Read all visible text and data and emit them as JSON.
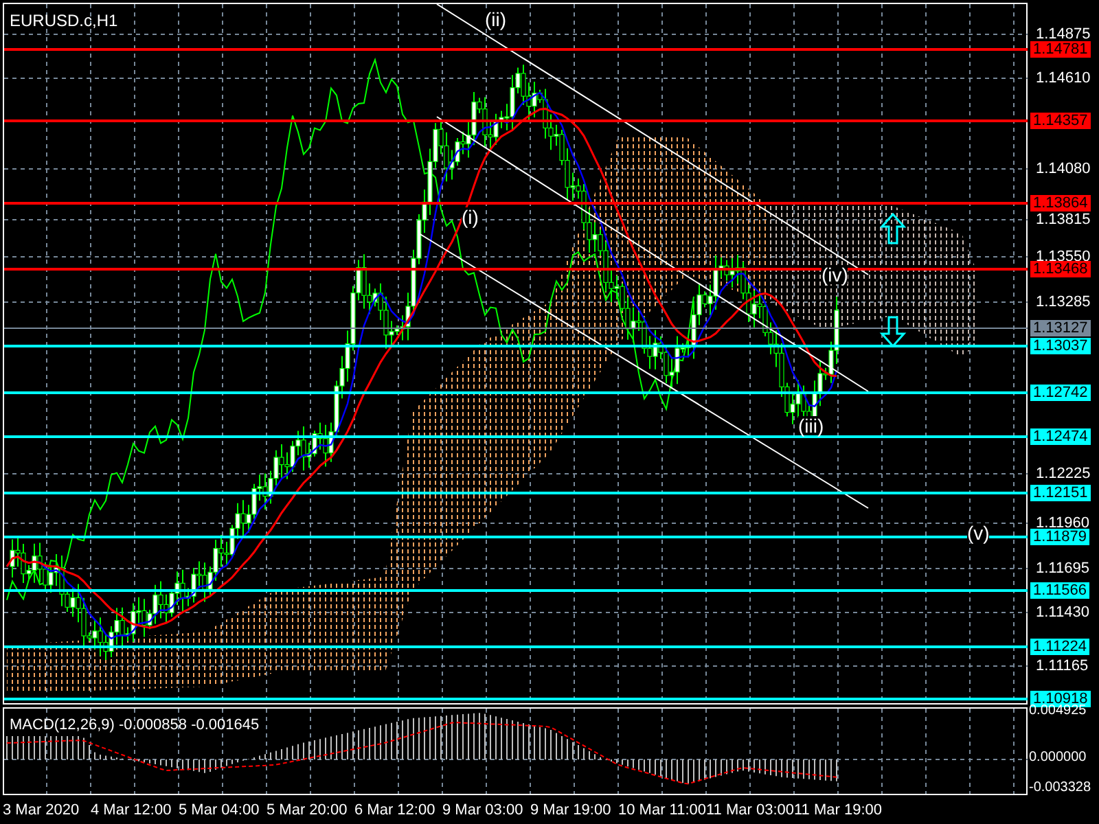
{
  "chart": {
    "title": "EURUSD.c,H1"
  },
  "wave_labels": [
    "(i)",
    "(ii)",
    "(iii)",
    "(iv)",
    "(v)"
  ],
  "price_axis": [
    {
      "kind": "tick",
      "text": "1.14875"
    },
    {
      "kind": "level",
      "text": "1.14781",
      "color": "#ff0000"
    },
    {
      "kind": "tick",
      "text": "1.14610"
    },
    {
      "kind": "level",
      "text": "1.14357",
      "color": "#ff0000"
    },
    {
      "kind": "tick",
      "text": "1.14080"
    },
    {
      "kind": "level",
      "text": "1.13864",
      "color": "#ff0000"
    },
    {
      "kind": "tick",
      "text": "1.13815"
    },
    {
      "kind": "tick",
      "text": "1.13550"
    },
    {
      "kind": "level",
      "text": "1.13468",
      "color": "#ff0000"
    },
    {
      "kind": "tick",
      "text": "1.13285"
    },
    {
      "kind": "level",
      "text": "1.13127",
      "color": "#778899"
    },
    {
      "kind": "level",
      "text": "1.13037",
      "color": "#00ffff"
    },
    {
      "kind": "level",
      "text": "1.12742",
      "color": "#00ffff"
    },
    {
      "kind": "level",
      "text": "1.12474",
      "color": "#00ffff"
    },
    {
      "kind": "tick",
      "text": "1.12225"
    },
    {
      "kind": "level",
      "text": "1.12151",
      "color": "#00ffff"
    },
    {
      "kind": "tick",
      "text": "1.11960"
    },
    {
      "kind": "level",
      "text": "1.11879",
      "color": "#00ffff"
    },
    {
      "kind": "tick",
      "text": "1.11695"
    },
    {
      "kind": "level",
      "text": "1.11566",
      "color": "#00ffff"
    },
    {
      "kind": "tick",
      "text": "1.11430"
    },
    {
      "kind": "level",
      "text": "1.11224",
      "color": "#00ffff"
    },
    {
      "kind": "tick",
      "text": "1.11165"
    },
    {
      "kind": "level",
      "text": "1.10918",
      "color": "#00ffff"
    }
  ],
  "macd": {
    "label": "MACD(12,26,9) -0.000858 -0.001645",
    "axis": [
      "0.004925",
      "0.000000",
      "-0.003328"
    ]
  },
  "time_axis": [
    "3 Mar 2020",
    "4 Mar 12:00",
    "5 Mar 04:00",
    "5 Mar 20:00",
    "6 Mar 12:00",
    "9 Mar 03:00",
    "9 Mar 19:00",
    "10 Mar 11:00",
    "11 Mar 03:00",
    "11 Mar 19:00"
  ]
}
